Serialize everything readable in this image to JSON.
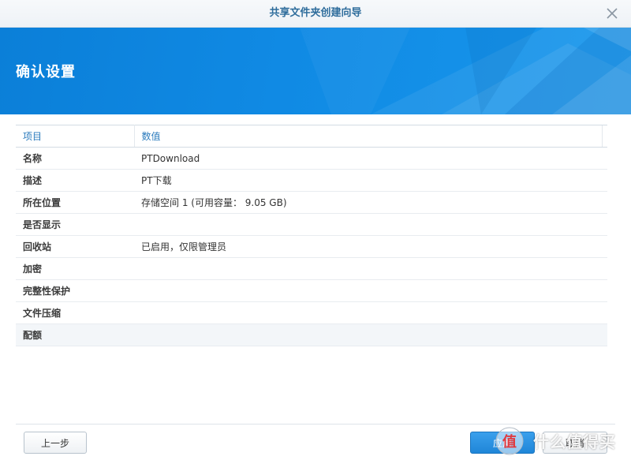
{
  "window": {
    "title": "共享文件夹创建向导",
    "close_icon": "close-icon"
  },
  "banner": {
    "title": "确认设置"
  },
  "table": {
    "headers": [
      "项目",
      "数值"
    ],
    "rows": [
      {
        "item": "名称",
        "value": "PTDownload"
      },
      {
        "item": "描述",
        "value": "PT下载"
      },
      {
        "item": "所在位置",
        "value": "存储空间 1 (可用容量： 9.05 GB)"
      },
      {
        "item": "是否显示",
        "value": ""
      },
      {
        "item": "回收站",
        "value": "已启用，仅限管理员"
      },
      {
        "item": "加密",
        "value": ""
      },
      {
        "item": "完整性保护",
        "value": ""
      },
      {
        "item": "文件压缩",
        "value": ""
      },
      {
        "item": "配额",
        "value": ""
      }
    ]
  },
  "footer": {
    "prev_label": "上一步",
    "apply_label": "应用",
    "cancel_label": "取消"
  },
  "watermark": {
    "text": "什么值得买",
    "logo_glyph": "值"
  },
  "colors": {
    "accent": "#108ae4",
    "title_text": "#2f6d9c",
    "header_text": "#2b7bbd"
  }
}
